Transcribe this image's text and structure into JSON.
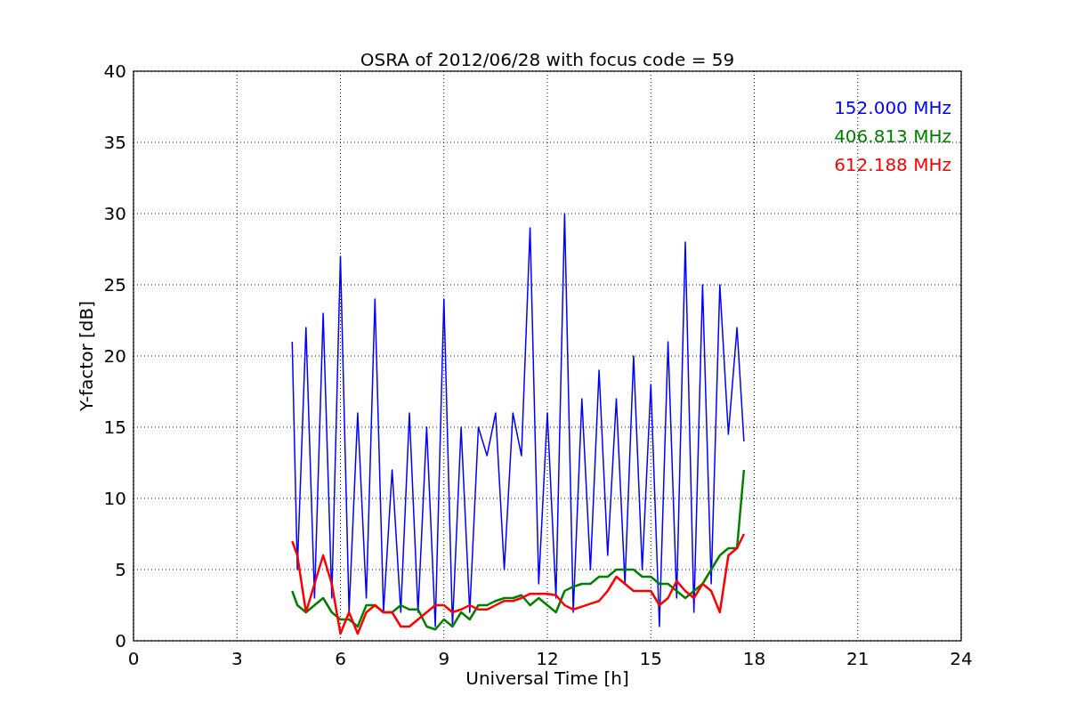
{
  "chart_data": {
    "type": "line",
    "title": "OSRA of 2012/06/28 with focus code = 59",
    "xlabel": "Universal Time [h]",
    "ylabel": "Y-factor [dB]",
    "x": [
      4.6,
      4.75,
      5,
      5.25,
      5.5,
      5.75,
      6,
      6.25,
      6.5,
      6.75,
      7,
      7.25,
      7.5,
      7.75,
      8,
      8.25,
      8.5,
      8.75,
      9,
      9.25,
      9.5,
      9.75,
      10,
      10.25,
      10.5,
      10.75,
      11,
      11.25,
      11.5,
      11.75,
      12,
      12.25,
      12.5,
      12.75,
      13,
      13.25,
      13.5,
      13.75,
      14,
      14.25,
      14.5,
      14.75,
      15,
      15.25,
      15.5,
      15.75,
      16,
      16.25,
      16.5,
      16.75,
      17,
      17.25,
      17.5,
      17.7
    ],
    "series": [
      {
        "name": "152.000 MHz",
        "color": "#0000ff",
        "values": [
          21,
          5,
          22,
          3,
          23,
          3,
          27,
          2,
          16,
          3,
          24,
          2,
          12,
          2,
          16,
          2,
          15,
          1,
          24,
          1,
          15,
          2,
          15,
          13,
          16,
          5,
          16,
          13,
          29,
          4,
          16,
          3,
          30,
          2,
          17,
          5,
          19,
          6,
          17,
          4,
          20,
          5,
          18,
          1,
          21,
          3,
          28,
          2,
          25,
          4,
          25,
          14.5,
          22,
          14
        ]
      },
      {
        "name": "406.813 MHz",
        "color": "#008000",
        "values": [
          3.5,
          2.5,
          2,
          2.5,
          3,
          2,
          1.5,
          1.5,
          1,
          2.5,
          2.5,
          2,
          2,
          2.5,
          2.2,
          2.2,
          1,
          0.8,
          1.5,
          1,
          2,
          1.5,
          2.5,
          2.5,
          2.8,
          3,
          3,
          3.2,
          2.5,
          3,
          2.5,
          2,
          3.5,
          3.8,
          4,
          4,
          4.5,
          4.5,
          5,
          5,
          5,
          4.5,
          4.5,
          4,
          4,
          3.5,
          3,
          3.5,
          4,
          5,
          6,
          6.5,
          6.5,
          12
        ]
      },
      {
        "name": "612.188 MHz",
        "color": "#ff0000",
        "values": [
          7,
          6,
          2,
          4,
          6,
          4,
          0.5,
          2,
          0.5,
          2,
          2.5,
          2,
          2,
          1,
          1,
          1.5,
          2,
          2.5,
          2.5,
          2,
          2.2,
          2.5,
          2.2,
          2.2,
          2.5,
          2.8,
          2.8,
          3,
          3.3,
          3.3,
          3.3,
          3.2,
          2.5,
          2.2,
          2.4,
          2.6,
          2.8,
          3.5,
          4.5,
          4,
          3.5,
          3.5,
          3.5,
          2.5,
          3,
          4.2,
          3.5,
          3,
          4,
          3.5,
          2,
          6,
          6.5,
          7.5
        ]
      }
    ],
    "xlim": [
      0,
      24
    ],
    "ylim": [
      0,
      40
    ],
    "xticks": [
      0,
      3,
      6,
      9,
      12,
      15,
      18,
      21,
      24
    ],
    "yticks": [
      0,
      5,
      10,
      15,
      20,
      25,
      30,
      35,
      40
    ],
    "grid": true
  }
}
